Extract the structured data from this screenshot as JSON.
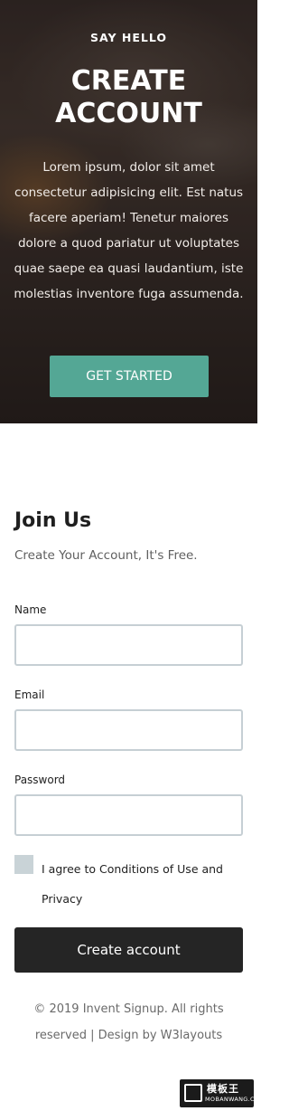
{
  "hero": {
    "kicker": "SAY HELLO",
    "title_line1": "CREATE",
    "title_line2": "ACCOUNT",
    "text": "Lorem ipsum, dolor sit amet consectetur adipisicing elit. Est natus facere aperiam! Tenetur maiores dolore a quod pariatur ut voluptates quae saepe ea quasi laudantium, iste molestias inventore fuga assumenda.",
    "cta_label": "GET STARTED",
    "accent_color": "#54a795"
  },
  "form": {
    "title": "Join Us",
    "subtitle": "Create Your Account, It's Free.",
    "fields": [
      {
        "label": "Name",
        "value": "",
        "placeholder": ""
      },
      {
        "label": "Email",
        "value": "",
        "placeholder": ""
      },
      {
        "label": "Password",
        "value": "",
        "placeholder": ""
      }
    ],
    "agree_text": "I agree to Conditions of Use and Privacy",
    "submit_label": "Create account"
  },
  "footer": {
    "text": "© 2019 Invent Signup. All rights reserved | Design by W3layouts"
  },
  "watermark": {
    "chinese": "模板王",
    "english": "MOBANWANG.COM",
    "icon": "stack-icon"
  }
}
